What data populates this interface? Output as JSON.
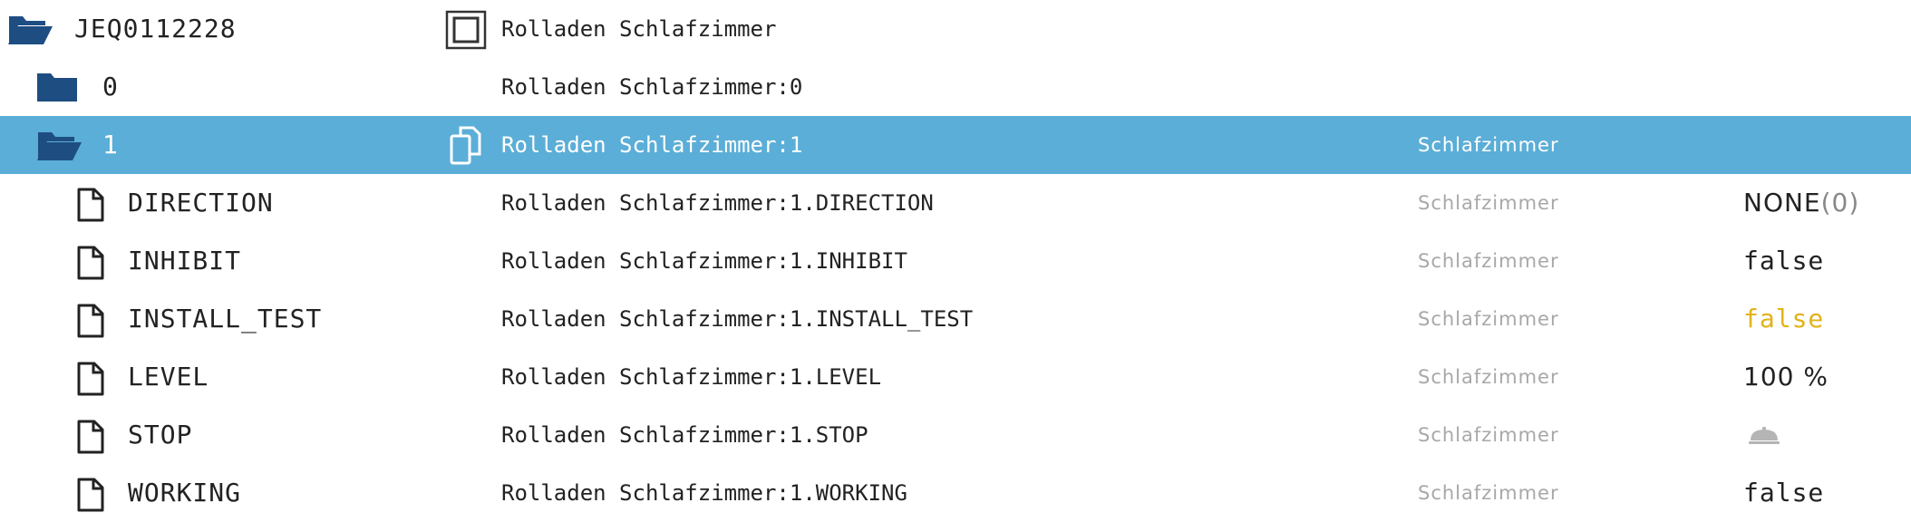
{
  "colors": {
    "selected_row": "#5baed7",
    "folder": "#1e4d82",
    "warning_value": "#e3b219",
    "muted": "#a8a8a8"
  },
  "device": {
    "name": "JEQ0112228",
    "address": "Rolladen Schlafzimmer",
    "icon": "device-icon"
  },
  "channels": [
    {
      "name": "0",
      "address": "Rolladen Schlafzimmer:0",
      "room": "",
      "icon": "folder-icon"
    },
    {
      "name": "1",
      "address": "Rolladen Schlafzimmer:1",
      "room": "Schlafzimmer",
      "icon": "folder-open-icon",
      "selected": true
    }
  ],
  "datapoints": [
    {
      "name": "DIRECTION",
      "address": "Rolladen Schlafzimmer:1.DIRECTION",
      "room": "Schlafzimmer",
      "value": "NONE",
      "value_suffix": "(0)"
    },
    {
      "name": "INHIBIT",
      "address": "Rolladen Schlafzimmer:1.INHIBIT",
      "room": "Schlafzimmer",
      "value": "false"
    },
    {
      "name": "INSTALL_TEST",
      "address": "Rolladen Schlafzimmer:1.INSTALL_TEST",
      "room": "Schlafzimmer",
      "value": "false"
    },
    {
      "name": "LEVEL",
      "address": "Rolladen Schlafzimmer:1.LEVEL",
      "room": "Schlafzimmer",
      "value": "100 %"
    },
    {
      "name": "STOP",
      "address": "Rolladen Schlafzimmer:1.STOP",
      "room": "Schlafzimmer",
      "value_icon": "bell-icon"
    },
    {
      "name": "WORKING",
      "address": "Rolladen Schlafzimmer:1.WORKING",
      "room": "Schlafzimmer",
      "value": "false"
    }
  ]
}
